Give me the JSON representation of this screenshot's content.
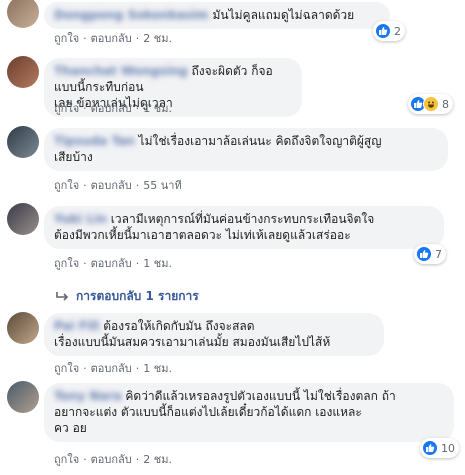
{
  "comments": [
    {
      "name": "Dongpong Sokonkasim",
      "text_lines": [
        "มันไม่คูลแถมดูไม่ฉลาดด้วย"
      ],
      "meta": {
        "like": "ถูกใจ",
        "reply": "ตอบกลับ",
        "time": "2 ชม."
      },
      "reactions": {
        "icons": [
          "like-icon"
        ],
        "count": "2"
      }
    },
    {
      "name": "Thanchat Wongsing",
      "text_lines": [
        "ถึงจะผิดตัว ก็จอแบบนี้กระทืบก่อน",
        "เลย ข้อหาเล่นไม่ดูเวลา"
      ],
      "meta": {
        "like": "ถูกใจ",
        "reply": "ตอบกลับ",
        "time": "1 ชม."
      },
      "reactions": {
        "icons": [
          "like-icon",
          "haha-icon"
        ],
        "count": "8"
      }
    },
    {
      "name": "Tipsuda Tan",
      "text_lines": [
        "ไม่ใช่เรื่องเอามาล้อเล่นนะ คิดถึงจิตใจญาติผู้สูญ",
        "เสียบ้าง"
      ],
      "meta": {
        "like": "ถูกใจ",
        "reply": "ตอบกลับ",
        "time": "55 นาที"
      },
      "reactions": null
    },
    {
      "name": "Yuki Lin",
      "text_lines": [
        "เวลามีเหตุการณ์ที่มันค่อนข้างกระทบกระเทือนจิตใจ",
        "ต้องมีพวกเหี้ยนี้มาเอาฮาตลอดวะ ไม่เท่เห้เลยดูแล้วเสร่ออะ"
      ],
      "meta": {
        "like": "ถูกใจ",
        "reply": "ตอบกลับ",
        "time": "1 ชม."
      },
      "reactions": {
        "icons": [
          "like-icon"
        ],
        "count": "7"
      }
    },
    {
      "name": "Pai Fill",
      "text_lines": [
        "ต้องรอให้เกิดกับมัน ถึงจะสลด",
        "เรื่องแบบนี้มันสมควรเอามาเล่นมั้ย สมองมันเสียไปไส้ห้"
      ],
      "meta": {
        "like": "ถูกใจ",
        "reply": "ตอบกลับ",
        "time": "1 ชม."
      },
      "reactions": null
    },
    {
      "name": "Tony Nara",
      "text_lines": [
        "คิดว่าดีแล้วเหรอลงรูปตัวเองแบบนี้ ไม่ใช่เรื่องตลก ถ้า",
        "อยากจะแต่ง ตัวแบบนี้ก็อแต่งไปเล้ยเดี๋ยวก้อได้แดก   เองแหละ",
        "คว   อย"
      ],
      "meta": {
        "like": "ถูกใจ",
        "reply": "ตอบกลับ",
        "time": "2 ชม."
      },
      "reactions": {
        "icons": [
          "like-icon"
        ],
        "count": "10"
      }
    }
  ],
  "replies_link": "การตอบกลับ 1 รายการ",
  "colors": {
    "bubble": "#f2f3f5",
    "name": "#385898",
    "meta": "#606770",
    "like": "#1877f2",
    "haha": "#f7c33b"
  }
}
